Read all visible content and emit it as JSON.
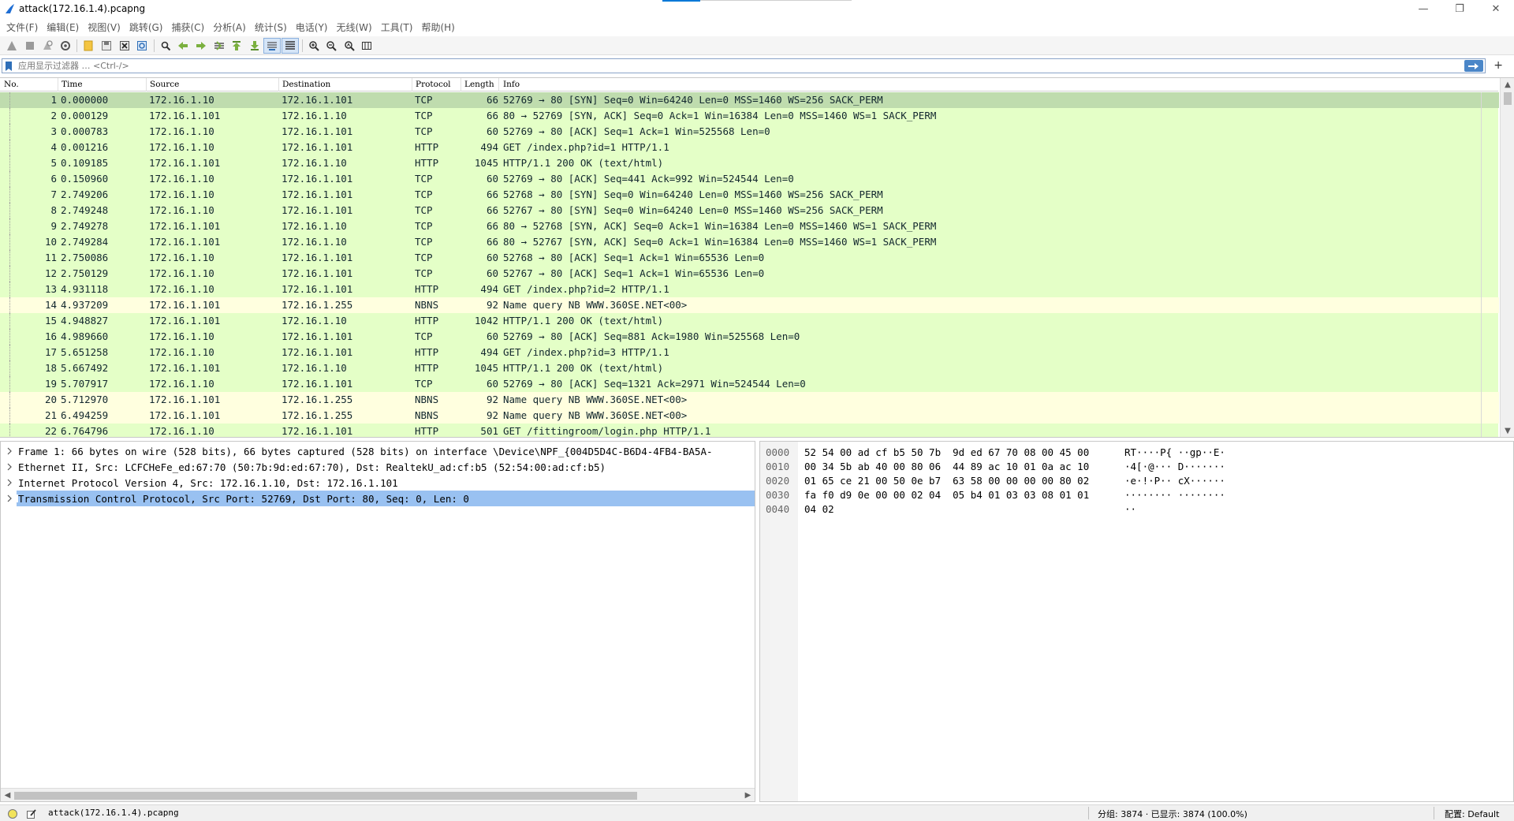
{
  "window": {
    "title": "attack(172.16.1.4).pcapng",
    "minimize_glyph": "—",
    "restore_glyph": "❐",
    "close_glyph": "✕"
  },
  "menu": [
    "文件(F)",
    "编辑(E)",
    "视图(V)",
    "跳转(G)",
    "捕获(C)",
    "分析(A)",
    "统计(S)",
    "电话(Y)",
    "无线(W)",
    "工具(T)",
    "帮助(H)"
  ],
  "toolbar": {
    "icons": [
      "start-capture-icon",
      "stop-capture-icon",
      "restart-capture-icon",
      "capture-options-icon",
      "open-file-icon",
      "save-file-icon",
      "close-file-icon",
      "reload-file-icon",
      "find-packet-icon",
      "go-back-icon",
      "go-forward-icon",
      "go-to-packet-icon",
      "go-first-icon",
      "go-last-icon",
      "autoscroll-icon",
      "colorize-icon",
      "zoom-in-icon",
      "zoom-out-icon",
      "zoom-normal-icon",
      "resize-columns-icon"
    ]
  },
  "filter": {
    "placeholder": "应用显示过滤器 … <Ctrl-/>",
    "plus": "+"
  },
  "packet_list": {
    "columns": [
      "No.",
      "Time",
      "Source",
      "Destination",
      "Protocol",
      "Length",
      "Info"
    ],
    "rows": [
      {
        "no": "1",
        "time": "0.000000",
        "src": "172.16.1.10",
        "dst": "172.16.1.101",
        "proto": "TCP",
        "len": "66",
        "info": "52769 → 80 [SYN] Seq=0 Win=64240 Len=0 MSS=1460 WS=256 SACK_PERM",
        "kind": "tcp"
      },
      {
        "no": "2",
        "time": "0.000129",
        "src": "172.16.1.101",
        "dst": "172.16.1.10",
        "proto": "TCP",
        "len": "66",
        "info": "80 → 52769 [SYN, ACK] Seq=0 Ack=1 Win=16384 Len=0 MSS=1460 WS=1 SACK_PERM",
        "kind": "tcp"
      },
      {
        "no": "3",
        "time": "0.000783",
        "src": "172.16.1.10",
        "dst": "172.16.1.101",
        "proto": "TCP",
        "len": "60",
        "info": "52769 → 80 [ACK] Seq=1 Ack=1 Win=525568 Len=0",
        "kind": "tcp"
      },
      {
        "no": "4",
        "time": "0.001216",
        "src": "172.16.1.10",
        "dst": "172.16.1.101",
        "proto": "HTTP",
        "len": "494",
        "info": "GET /index.php?id=1 HTTP/1.1",
        "kind": "tcp"
      },
      {
        "no": "5",
        "time": "0.109185",
        "src": "172.16.1.101",
        "dst": "172.16.1.10",
        "proto": "HTTP",
        "len": "1045",
        "info": "HTTP/1.1 200 OK  (text/html)",
        "kind": "tcp"
      },
      {
        "no": "6",
        "time": "0.150960",
        "src": "172.16.1.10",
        "dst": "172.16.1.101",
        "proto": "TCP",
        "len": "60",
        "info": "52769 → 80 [ACK] Seq=441 Ack=992 Win=524544 Len=0",
        "kind": "tcp"
      },
      {
        "no": "7",
        "time": "2.749206",
        "src": "172.16.1.10",
        "dst": "172.16.1.101",
        "proto": "TCP",
        "len": "66",
        "info": "52768 → 80 [SYN] Seq=0 Win=64240 Len=0 MSS=1460 WS=256 SACK_PERM",
        "kind": "tcp"
      },
      {
        "no": "8",
        "time": "2.749248",
        "src": "172.16.1.10",
        "dst": "172.16.1.101",
        "proto": "TCP",
        "len": "66",
        "info": "52767 → 80 [SYN] Seq=0 Win=64240 Len=0 MSS=1460 WS=256 SACK_PERM",
        "kind": "tcp"
      },
      {
        "no": "9",
        "time": "2.749278",
        "src": "172.16.1.101",
        "dst": "172.16.1.10",
        "proto": "TCP",
        "len": "66",
        "info": "80 → 52768 [SYN, ACK] Seq=0 Ack=1 Win=16384 Len=0 MSS=1460 WS=1 SACK_PERM",
        "kind": "tcp"
      },
      {
        "no": "10",
        "time": "2.749284",
        "src": "172.16.1.101",
        "dst": "172.16.1.10",
        "proto": "TCP",
        "len": "66",
        "info": "80 → 52767 [SYN, ACK] Seq=0 Ack=1 Win=16384 Len=0 MSS=1460 WS=1 SACK_PERM",
        "kind": "tcp"
      },
      {
        "no": "11",
        "time": "2.750086",
        "src": "172.16.1.10",
        "dst": "172.16.1.101",
        "proto": "TCP",
        "len": "60",
        "info": "52768 → 80 [ACK] Seq=1 Ack=1 Win=65536 Len=0",
        "kind": "tcp"
      },
      {
        "no": "12",
        "time": "2.750129",
        "src": "172.16.1.10",
        "dst": "172.16.1.101",
        "proto": "TCP",
        "len": "60",
        "info": "52767 → 80 [ACK] Seq=1 Ack=1 Win=65536 Len=0",
        "kind": "tcp"
      },
      {
        "no": "13",
        "time": "4.931118",
        "src": "172.16.1.10",
        "dst": "172.16.1.101",
        "proto": "HTTP",
        "len": "494",
        "info": "GET /index.php?id=2 HTTP/1.1",
        "kind": "tcp"
      },
      {
        "no": "14",
        "time": "4.937209",
        "src": "172.16.1.101",
        "dst": "172.16.1.255",
        "proto": "NBNS",
        "len": "92",
        "info": "Name query NB WWW.360SE.NET<00>",
        "kind": "udp"
      },
      {
        "no": "15",
        "time": "4.948827",
        "src": "172.16.1.101",
        "dst": "172.16.1.10",
        "proto": "HTTP",
        "len": "1042",
        "info": "HTTP/1.1 200 OK  (text/html)",
        "kind": "tcp"
      },
      {
        "no": "16",
        "time": "4.989660",
        "src": "172.16.1.10",
        "dst": "172.16.1.101",
        "proto": "TCP",
        "len": "60",
        "info": "52769 → 80 [ACK] Seq=881 Ack=1980 Win=525568 Len=0",
        "kind": "tcp"
      },
      {
        "no": "17",
        "time": "5.651258",
        "src": "172.16.1.10",
        "dst": "172.16.1.101",
        "proto": "HTTP",
        "len": "494",
        "info": "GET /index.php?id=3 HTTP/1.1",
        "kind": "tcp"
      },
      {
        "no": "18",
        "time": "5.667492",
        "src": "172.16.1.101",
        "dst": "172.16.1.10",
        "proto": "HTTP",
        "len": "1045",
        "info": "HTTP/1.1 200 OK  (text/html)",
        "kind": "tcp"
      },
      {
        "no": "19",
        "time": "5.707917",
        "src": "172.16.1.10",
        "dst": "172.16.1.101",
        "proto": "TCP",
        "len": "60",
        "info": "52769 → 80 [ACK] Seq=1321 Ack=2971 Win=524544 Len=0",
        "kind": "tcp"
      },
      {
        "no": "20",
        "time": "5.712970",
        "src": "172.16.1.101",
        "dst": "172.16.1.255",
        "proto": "NBNS",
        "len": "92",
        "info": "Name query NB WWW.360SE.NET<00>",
        "kind": "udp"
      },
      {
        "no": "21",
        "time": "6.494259",
        "src": "172.16.1.101",
        "dst": "172.16.1.255",
        "proto": "NBNS",
        "len": "92",
        "info": "Name query NB WWW.360SE.NET<00>",
        "kind": "udp"
      },
      {
        "no": "22",
        "time": "6.764796",
        "src": "172.16.1.10",
        "dst": "172.16.1.101",
        "proto": "HTTP",
        "len": "501",
        "info": "GET /fittingroom/login.php HTTP/1.1",
        "kind": "tcp"
      }
    ],
    "selected_index": 0
  },
  "details": {
    "rows": [
      "Frame 1: 66 bytes on wire (528 bits), 66 bytes captured (528 bits) on interface \\Device\\NPF_{004D5D4C-B6D4-4FB4-BA5A-",
      "Ethernet II, Src: LCFCHeFe_ed:67:70 (50:7b:9d:ed:67:70), Dst: RealtekU_ad:cf:b5 (52:54:00:ad:cf:b5)",
      "Internet Protocol Version 4, Src: 172.16.1.10, Dst: 172.16.1.101",
      "Transmission Control Protocol, Src Port: 52769, Dst Port: 80, Seq: 0, Len: 0"
    ],
    "selected_index": 3
  },
  "bytes": {
    "rows": [
      {
        "offset": "0000",
        "hex": "52 54 00 ad cf b5 50 7b  9d ed 67 70 08 00 45 00",
        "ascii": "RT····P{ ··gp··E·"
      },
      {
        "offset": "0010",
        "hex": "00 34 5b ab 40 00 80 06  44 89 ac 10 01 0a ac 10",
        "ascii": "·4[·@··· D·······"
      },
      {
        "offset": "0020",
        "hex": "01 65 ce 21 00 50 0e b7  63 58 00 00 00 00 80 02",
        "ascii": "·e·!·P·· cX······"
      },
      {
        "offset": "0030",
        "hex": "fa f0 d9 0e 00 00 02 04  05 b4 01 03 03 08 01 01",
        "ascii": "········ ········"
      },
      {
        "offset": "0040",
        "hex": "04 02",
        "ascii": "··"
      }
    ]
  },
  "status": {
    "file": "attack(172.16.1.4).pcapng",
    "packets": "分组: 3874 · 已显示: 3874 (100.0%)",
    "profile": "配置: Default"
  },
  "colors": {
    "tcp_row": "#e4ffc7",
    "udp_row": "#ffffdf",
    "selected_row": "#bfdcae",
    "selected_detail": "#99c1f1",
    "accent": "#0078d7"
  }
}
